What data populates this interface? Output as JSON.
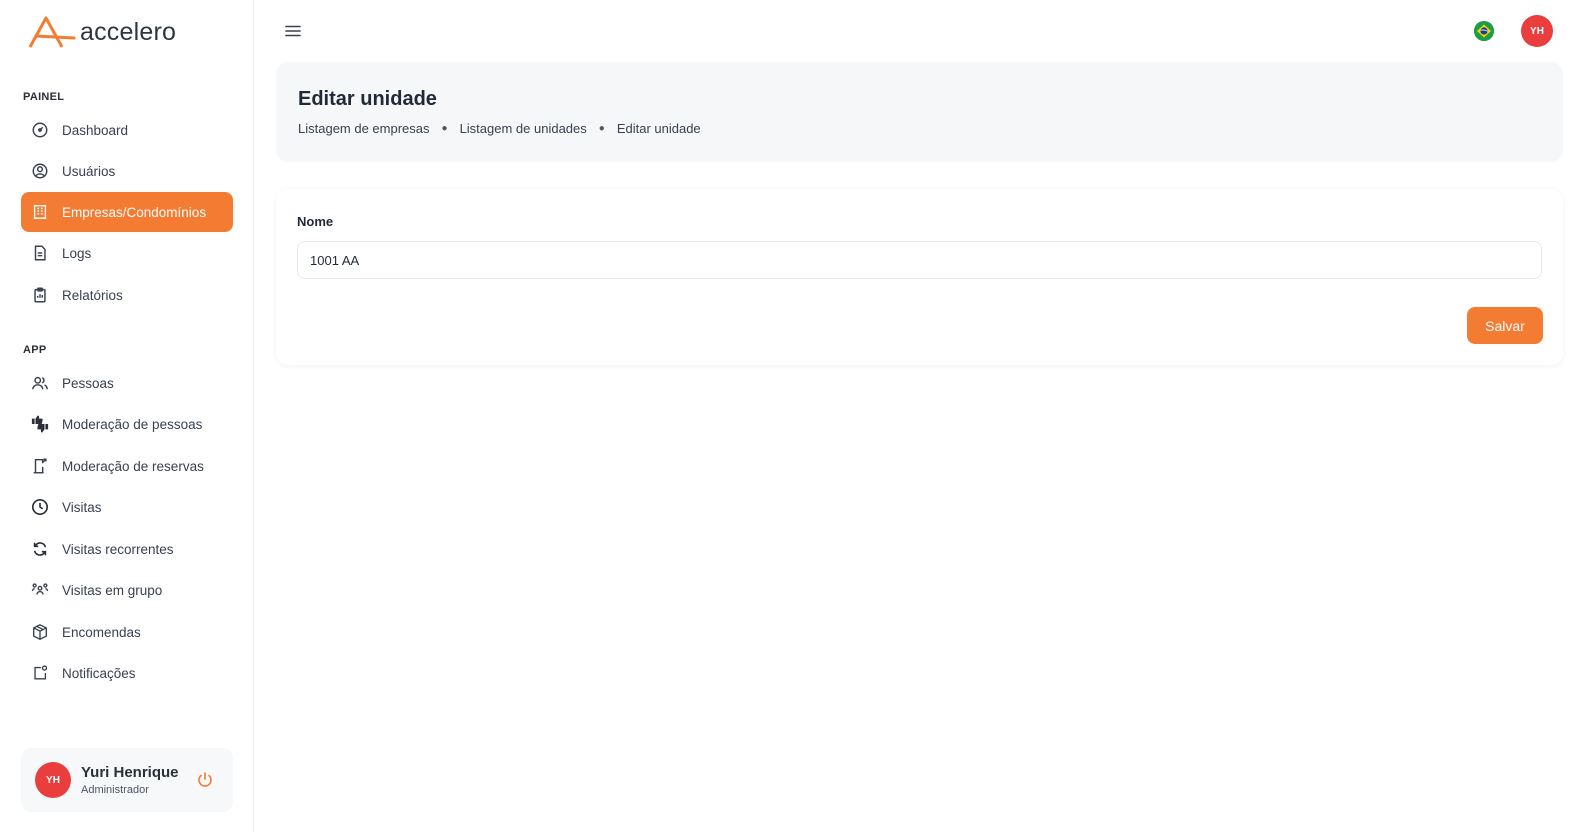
{
  "brand": {
    "name": "accelero",
    "accent": "#f47c32",
    "avatar_color": "#ea3d3d"
  },
  "sidebar": {
    "sections": [
      {
        "title": "PAINEL",
        "items": [
          {
            "label": "Dashboard",
            "icon": "dashboard-icon",
            "active": false
          },
          {
            "label": "Usuários",
            "icon": "user-circle-icon",
            "active": false
          },
          {
            "label": "Empresas/Condomínios",
            "icon": "building-icon",
            "active": true
          },
          {
            "label": "Logs",
            "icon": "document-icon",
            "active": false
          },
          {
            "label": "Relatórios",
            "icon": "clipboard-icon",
            "active": false
          }
        ]
      },
      {
        "title": "APP",
        "items": [
          {
            "label": "Pessoas",
            "icon": "users-icon",
            "active": false
          },
          {
            "label": "Moderação de pessoas",
            "icon": "thumbs-icon",
            "active": false
          },
          {
            "label": "Moderação de reservas",
            "icon": "door-icon",
            "active": false
          },
          {
            "label": "Visitas",
            "icon": "clock-icon",
            "active": false
          },
          {
            "label": "Visitas recorrentes",
            "icon": "refresh-icon",
            "active": false
          },
          {
            "label": "Visitas em grupo",
            "icon": "group-icon",
            "active": false
          },
          {
            "label": "Encomendas",
            "icon": "box-icon",
            "active": false
          },
          {
            "label": "Notificações",
            "icon": "notification-icon",
            "active": false
          }
        ]
      }
    ],
    "user": {
      "initials": "YH",
      "name": "Yuri Henrique",
      "role": "Administrador"
    }
  },
  "topbar": {
    "user_initials": "YH",
    "language_flag": "brazil-flag-icon"
  },
  "header": {
    "title": "Editar unidade",
    "breadcrumb": [
      "Listagem de empresas",
      "Listagem de unidades",
      "Editar unidade"
    ]
  },
  "form": {
    "name_label": "Nome",
    "name_value": "1001 AA",
    "save_label": "Salvar"
  }
}
